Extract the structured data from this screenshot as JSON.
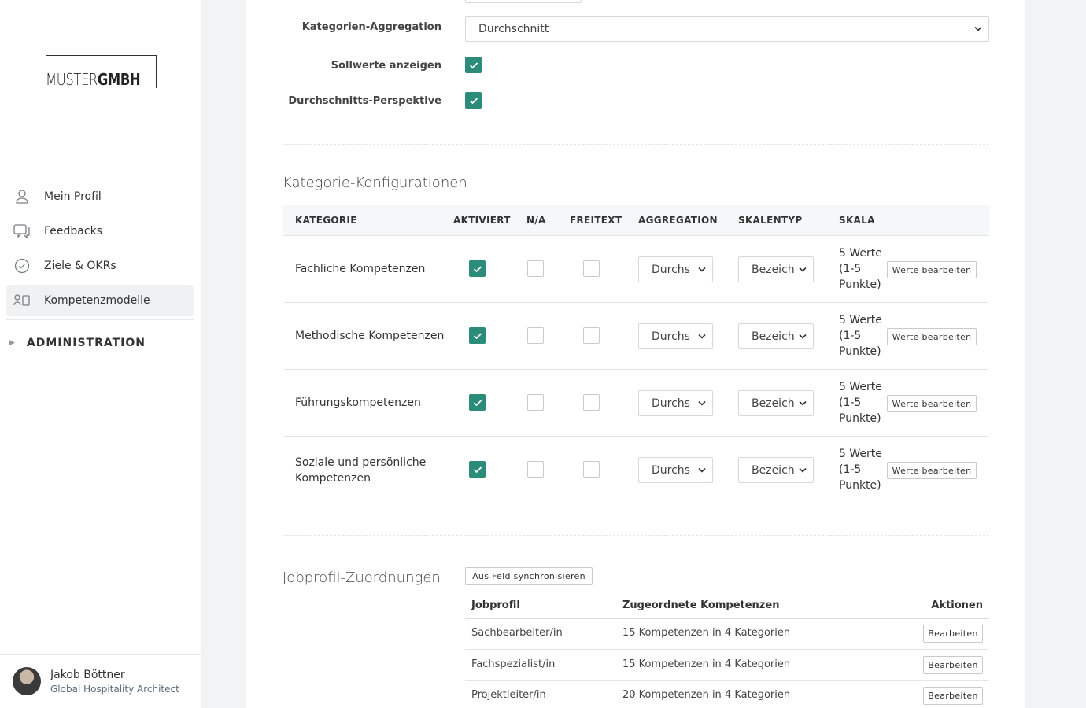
{
  "sidebar": {
    "logo": {
      "light": "MUSTER",
      "bold": "GMBH"
    },
    "nav": [
      {
        "label": "Mein Profil",
        "icon": "user-icon",
        "active": false
      },
      {
        "label": "Feedbacks",
        "icon": "chat-icon",
        "active": false
      },
      {
        "label": "Ziele & OKRs",
        "icon": "check-circle-icon",
        "active": false
      },
      {
        "label": "Kompetenzmodelle",
        "icon": "model-icon",
        "active": true
      }
    ],
    "admin_label": "ADMINISTRATION",
    "user": {
      "name": "Jakob Böttner",
      "role": "Global Hospitality Architect"
    }
  },
  "settings": {
    "aggregation_label": "Kategorien-Aggregation",
    "aggregation_value": "Durchschnitt",
    "targets_label": "Sollwerte anzeigen",
    "targets_checked": true,
    "avg_perspective_label": "Durchschnitts-Perspektive",
    "avg_perspective_checked": true
  },
  "category_config": {
    "title": "Kategorie-Konfigurationen",
    "headers": [
      "KATEGORIE",
      "AKTIVIERT",
      "N/A",
      "FREITEXT",
      "AGGREGATION",
      "SKALENTYP",
      "SKALA"
    ],
    "rows": [
      {
        "name": "Fachliche Kompetenzen",
        "active": true,
        "na": false,
        "freetext": false,
        "aggregation": "Durchs",
        "scale_type": "Bezeich",
        "scale": "5 Werte (1-5 Punkte)",
        "button": "Werte bearbeiten"
      },
      {
        "name": "Methodische Kompetenzen",
        "active": true,
        "na": false,
        "freetext": false,
        "aggregation": "Durchs",
        "scale_type": "Bezeich",
        "scale": "5 Werte (1-5 Punkte)",
        "button": "Werte bearbeiten"
      },
      {
        "name": "Führungskompetenzen",
        "active": true,
        "na": false,
        "freetext": false,
        "aggregation": "Durchs",
        "scale_type": "Bezeich",
        "scale": "5 Werte (1-5 Punkte)",
        "button": "Werte bearbeiten"
      },
      {
        "name": "Soziale und persönliche Kompetenzen",
        "active": true,
        "na": false,
        "freetext": false,
        "aggregation": "Durchs",
        "scale_type": "Bezeich",
        "scale": "5 Werte (1-5 Punkte)",
        "button": "Werte bearbeiten"
      }
    ]
  },
  "job_profiles": {
    "title": "Jobprofil-Zuordnungen",
    "sync_button": "Aus Feld synchronisieren",
    "headers": [
      "Jobprofil",
      "Zugeordnete Kompetenzen",
      "Aktionen"
    ],
    "rows": [
      {
        "profile": "Sachbearbeiter/in",
        "assigned": "15 Kompetenzen in 4 Kategorien",
        "action": "Bearbeiten"
      },
      {
        "profile": "Fachspezialist/in",
        "assigned": "15 Kompetenzen in 4 Kategorien",
        "action": "Bearbeiten"
      },
      {
        "profile": "Projektleiter/in",
        "assigned": "20 Kompetenzen in 4 Kategorien",
        "action": "Bearbeiten"
      }
    ]
  },
  "colors": {
    "accent": "#2a8c79",
    "page_bg": "#f2f3f5"
  }
}
